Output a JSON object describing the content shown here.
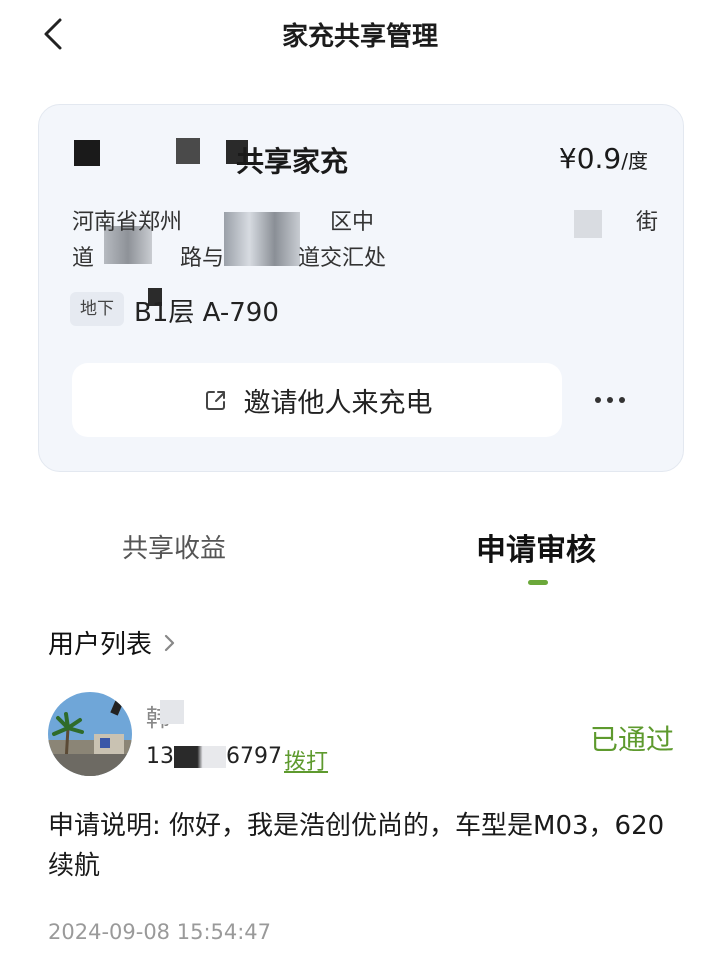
{
  "header": {
    "title": "家充共享管理"
  },
  "card": {
    "station_name": "共享家充",
    "price": "¥0.9",
    "price_unit": "/度",
    "address_line1": "河南省郑州",
    "address_line1_mid": "区中",
    "address_line1_end": "街",
    "address_line2_a": "道",
    "address_line2_b": "路与",
    "address_line2_c": "道交汇处",
    "level_tag": "地下",
    "level_text": "B1层 A-790",
    "invite_label": "邀请他人来充电"
  },
  "tabs": [
    {
      "label": "共享收益",
      "active": false
    },
    {
      "label": "申请审核",
      "active": true
    }
  ],
  "user_list": {
    "title": "用户列表",
    "items": [
      {
        "name": "韩",
        "phone_prefix": "13",
        "phone_suffix": "6797",
        "call_label": "拨打",
        "status": "已通过",
        "note": "申请说明: 你好，我是浩创优尚的，车型是M03，620续航",
        "time": "2024-09-08 15:54:47"
      }
    ]
  },
  "colors": {
    "accent_green": "#5e9a2e",
    "indicator_green": "#6ba83a",
    "card_bg": "#f3f6fb"
  },
  "icons": {
    "back": "chevron-left-icon",
    "share": "share-icon",
    "more": "more-icon",
    "chevron": "chevron-right-icon"
  }
}
